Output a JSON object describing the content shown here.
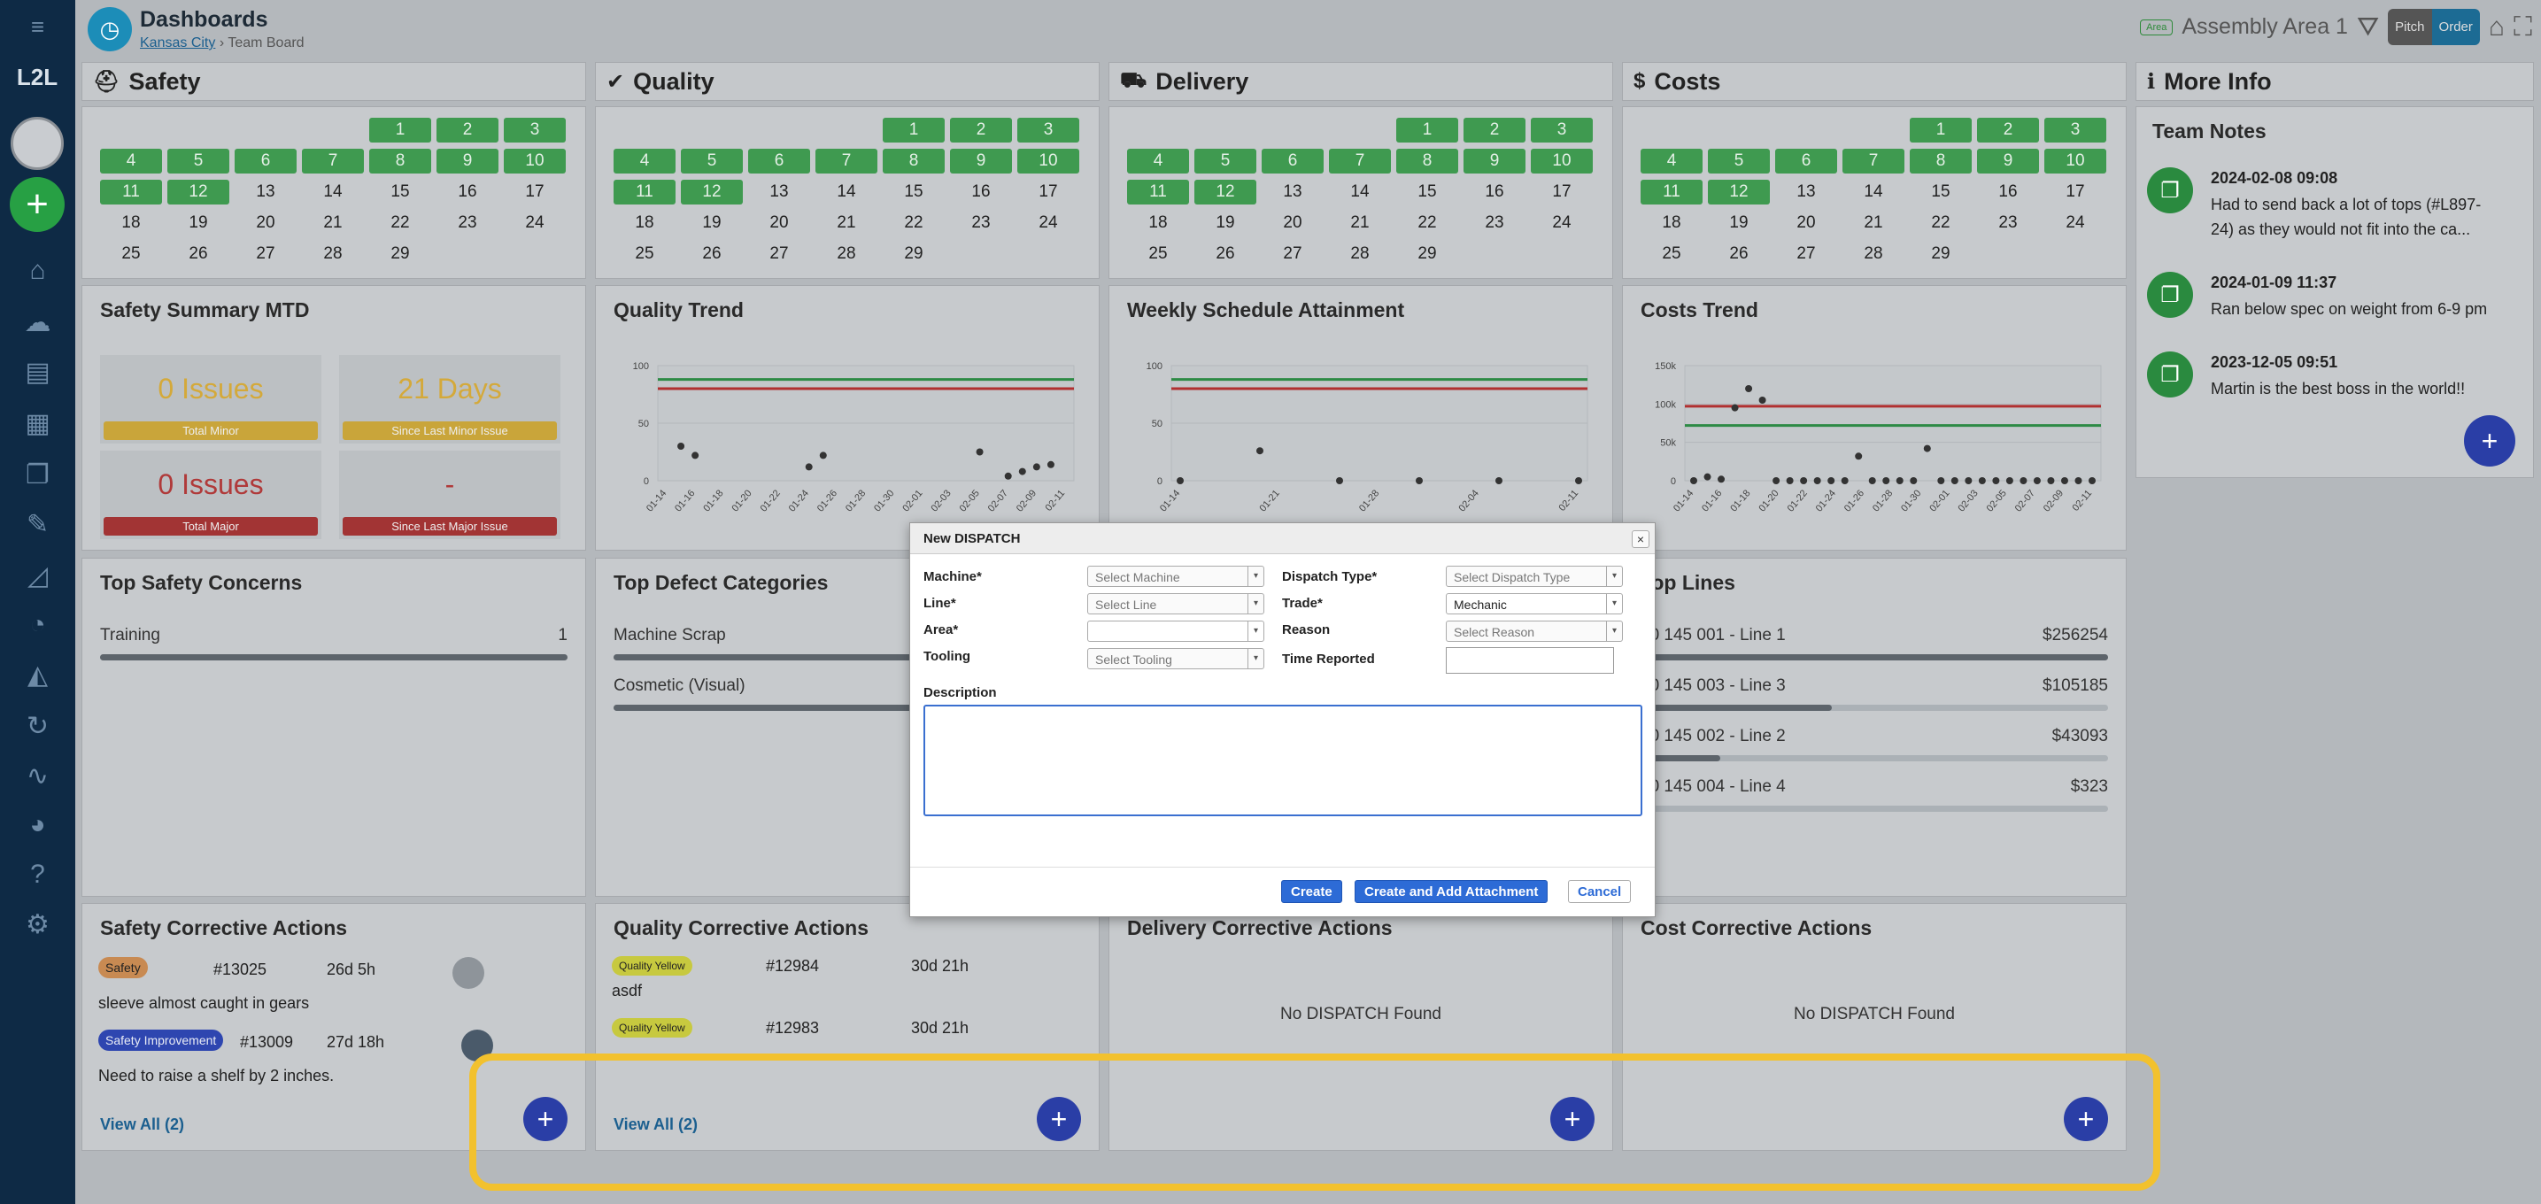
{
  "app": {
    "logo": "L2L"
  },
  "header": {
    "title": "Dashboards",
    "breadcrumb_location": "Kansas City",
    "breadcrumb_sep": "›",
    "breadcrumb_page": "Team Board",
    "area_badge": "Area",
    "area_name": "Assembly Area 1",
    "pitch_label": "Pitch",
    "order_label": "Order"
  },
  "sections": {
    "safety": "Safety",
    "quality": "Quality",
    "delivery": "Delivery",
    "costs": "Costs",
    "more_info": "More Info"
  },
  "calendar": {
    "days": [
      "1",
      "2",
      "3",
      "4",
      "5",
      "6",
      "7",
      "8",
      "9",
      "10",
      "11",
      "12",
      "13",
      "14",
      "15",
      "16",
      "17",
      "18",
      "19",
      "20",
      "21",
      "22",
      "23",
      "24",
      "25",
      "26",
      "27",
      "28",
      "29"
    ],
    "green_days": 12
  },
  "safety_summary": {
    "title": "Safety Summary MTD",
    "boxes": [
      {
        "value": "0 Issues",
        "label": "Total Minor",
        "color": "#d4a93a",
        "label_bg": "#c9a53a"
      },
      {
        "value": "21 Days",
        "label": "Since Last Minor Issue",
        "color": "#d4a93a",
        "label_bg": "#c9a53a"
      },
      {
        "value": "0 Issues",
        "label": "Total Major",
        "color": "#b03a3a",
        "label_bg": "#a23434"
      },
      {
        "value": "-",
        "label": "Since Last Major Issue",
        "color": "#b03a3a",
        "label_bg": "#a23434"
      }
    ]
  },
  "quality_trend": {
    "title": "Quality Trend"
  },
  "schedule": {
    "title": "Weekly Schedule Attainment"
  },
  "costs_trend": {
    "title": "Costs Trend"
  },
  "team_notes": {
    "title": "Team Notes",
    "notes": [
      {
        "date": "2024-02-08 09:08",
        "text": "Had to send back a lot of tops (#L897-24) as they would not fit into the ca..."
      },
      {
        "date": "2024-01-09 11:37",
        "text": "Ran below spec on weight from 6-9 pm"
      },
      {
        "date": "2023-12-05 09:51",
        "text": "Martin is the best boss in the world!!"
      }
    ]
  },
  "safety_concerns": {
    "title": "Top Safety Concerns",
    "rows": [
      {
        "label": "Training",
        "value": "1",
        "fraction": 1.0
      }
    ]
  },
  "defect_categories": {
    "title": "Top Defect Categories",
    "rows": [
      {
        "label": "Machine Scrap",
        "fraction": 1.0
      },
      {
        "label": "Cosmetic (Visual)",
        "fraction": 1.0
      }
    ]
  },
  "top_lines": {
    "title": "Top Lines",
    "rows": [
      {
        "label": "10 145 001 - Line 1",
        "value": "$256254",
        "fraction": 1.0
      },
      {
        "label": "10 145 003 - Line 3",
        "value": "$105185",
        "fraction": 0.41
      },
      {
        "label": "10 145 002 - Line 2",
        "value": "$43093",
        "fraction": 0.17
      },
      {
        "label": "10 145 004 - Line 4",
        "value": "$323",
        "fraction": 0.0
      }
    ]
  },
  "safety_ca": {
    "title": "Safety Corrective Actions",
    "items": [
      {
        "tag": "Safety",
        "tag_bg": "#c88a52",
        "id": "#13025",
        "age": "26d 5h",
        "desc": "sleeve almost caught in gears"
      },
      {
        "tag": "Safety Improvement",
        "tag_bg": "#2e46b0",
        "id": "#13009",
        "age": "27d 18h",
        "desc": "Need to raise a shelf by 2 inches."
      }
    ],
    "view_all": "View All (2)"
  },
  "quality_ca": {
    "title": "Quality Corrective Actions",
    "items": [
      {
        "tag": "Quality Yellow",
        "tag_bg": "#c7c93f",
        "id": "#12984",
        "age": "30d 21h",
        "desc": "asdf"
      },
      {
        "tag": "Quality Yellow",
        "tag_bg": "#c7c93f",
        "id": "#12983",
        "age": "30d 21h",
        "desc": ""
      }
    ],
    "view_all": "View All (2)"
  },
  "delivery_ca": {
    "title": "Delivery Corrective Actions",
    "empty": "No DISPATCH Found"
  },
  "cost_ca": {
    "title": "Cost Corrective Actions",
    "empty": "No DISPATCH Found"
  },
  "modal": {
    "title": "New DISPATCH",
    "close": "×",
    "machine_label": "Machine*",
    "machine_placeholder": "Select Machine",
    "line_label": "Line*",
    "line_placeholder": "Select Line",
    "area_label": "Area*",
    "area_value": "",
    "tooling_label": "Tooling",
    "tooling_placeholder": "Select Tooling",
    "dispatch_type_label": "Dispatch Type*",
    "dispatch_type_placeholder": "Select Dispatch Type",
    "trade_label": "Trade*",
    "trade_value": "Mechanic",
    "reason_label": "Reason",
    "reason_placeholder": "Select Reason",
    "time_reported_label": "Time Reported",
    "time_reported_value": "",
    "description_label": "Description",
    "description_value": "",
    "create": "Create",
    "create_attach": "Create and Add Attachment",
    "cancel": "Cancel"
  },
  "chart_data": [
    {
      "type": "scatter",
      "title": "Quality Trend",
      "x": [
        "01-14",
        "01-16",
        "01-18",
        "01-20",
        "01-22",
        "01-24",
        "01-26",
        "01-28",
        "01-30",
        "02-01",
        "02-03",
        "02-05",
        "02-07",
        "02-09",
        "02-11"
      ],
      "ylim": [
        0,
        100
      ],
      "yticks": [
        0,
        50,
        100
      ],
      "reference_lines": [
        {
          "value": 88,
          "color": "#2d8a45"
        },
        {
          "value": 80,
          "color": "#b13030"
        }
      ],
      "points": [
        [
          "01-15",
          30
        ],
        [
          "01-16",
          22
        ],
        [
          "01-24",
          12
        ],
        [
          "01-25",
          22
        ],
        [
          "02-05",
          25
        ],
        [
          "02-07",
          4
        ],
        [
          "02-08",
          8
        ],
        [
          "02-09",
          12
        ],
        [
          "02-10",
          14
        ]
      ]
    },
    {
      "type": "scatter",
      "title": "Weekly Schedule Attainment",
      "x": [
        "01-14",
        "01-21",
        "01-28",
        "02-04",
        "02-11"
      ],
      "ylim": [
        0,
        100
      ],
      "yticks": [
        0,
        50,
        100
      ],
      "reference_lines": [
        {
          "value": 88,
          "color": "#2d8a45"
        },
        {
          "value": 80,
          "color": "#b13030"
        }
      ],
      "points": [
        [
          "01-14",
          0
        ],
        [
          "01-21",
          26
        ],
        [
          "01-28",
          0
        ],
        [
          "02-04",
          0
        ],
        [
          "02-11",
          0
        ],
        [
          "02-18",
          0
        ]
      ]
    },
    {
      "type": "scatter",
      "title": "Costs Trend",
      "x": [
        "01-14",
        "01-16",
        "01-18",
        "01-20",
        "01-22",
        "01-24",
        "01-26",
        "01-28",
        "01-30",
        "02-01",
        "02-03",
        "02-05",
        "02-07",
        "02-09",
        "02-11"
      ],
      "ylim": [
        0,
        150000
      ],
      "yticks": [
        "0",
        "50k",
        "100k",
        "150k"
      ],
      "reference_lines": [
        {
          "value": 97000,
          "color": "#b13030"
        },
        {
          "value": 72000,
          "color": "#2d8a45"
        }
      ],
      "points": [
        [
          0,
          0
        ],
        [
          1,
          5000
        ],
        [
          2,
          2000
        ],
        [
          3,
          95000
        ],
        [
          4,
          120000
        ],
        [
          5,
          105000
        ],
        [
          6,
          0
        ],
        [
          7,
          0
        ],
        [
          8,
          0
        ],
        [
          9,
          0
        ],
        [
          10,
          0
        ],
        [
          11,
          0
        ],
        [
          12,
          32000
        ],
        [
          13,
          0
        ],
        [
          14,
          0
        ],
        [
          15,
          0
        ],
        [
          16,
          0
        ],
        [
          17,
          42000
        ],
        [
          18,
          0
        ],
        [
          19,
          0
        ],
        [
          20,
          0
        ],
        [
          21,
          0
        ],
        [
          22,
          0
        ],
        [
          23,
          0
        ],
        [
          24,
          0
        ],
        [
          25,
          0
        ],
        [
          26,
          0
        ],
        [
          27,
          0
        ],
        [
          28,
          0
        ],
        [
          29,
          0
        ]
      ]
    }
  ]
}
